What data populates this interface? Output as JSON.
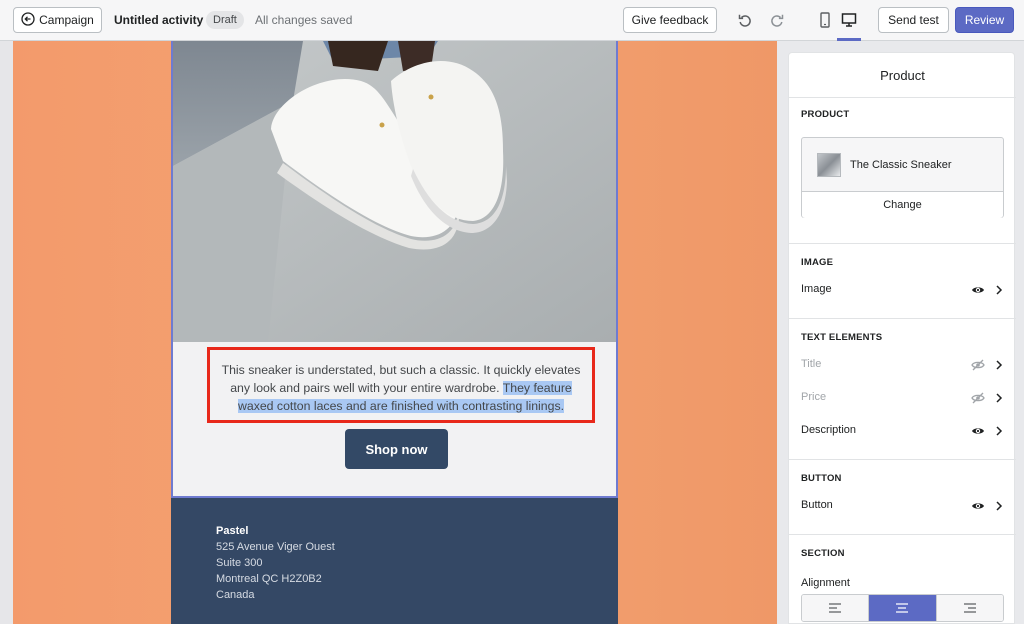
{
  "topbar": {
    "back_label": "Campaign",
    "activity_title": "Untitled activity",
    "status_badge": "Draft",
    "save_status": "All changes saved",
    "feedback_label": "Give feedback",
    "send_test_label": "Send test",
    "review_label": "Review",
    "accent_color": "#5c6ac4"
  },
  "email": {
    "description_plain": "This sneaker is understated, but such a classic. It quickly elevates any look and pairs well with your entire wardrobe.",
    "description_selected": "They feature waxed cotton laces and are finished with contrasting linings.",
    "cta_label": "Shop now",
    "footer": {
      "name": "Pastel",
      "address_1": "525 Avenue Viger Ouest",
      "address_2": "Suite 300",
      "address_3": "Montreal QC H2Z0B2",
      "country": "Canada"
    },
    "background_color": "#f4a373"
  },
  "sidebar": {
    "title": "Product",
    "product_section_label": "PRODUCT",
    "product_name": "The Classic Sneaker",
    "change_label": "Change",
    "image_section_label": "IMAGE",
    "image_row": "Image",
    "text_section_label": "TEXT ELEMENTS",
    "text_rows": [
      "Title",
      "Price",
      "Description"
    ],
    "button_section_label": "BUTTON",
    "button_row": "Button",
    "section_label": "SECTION",
    "alignment_label": "Alignment",
    "alignment_selected": "center"
  }
}
